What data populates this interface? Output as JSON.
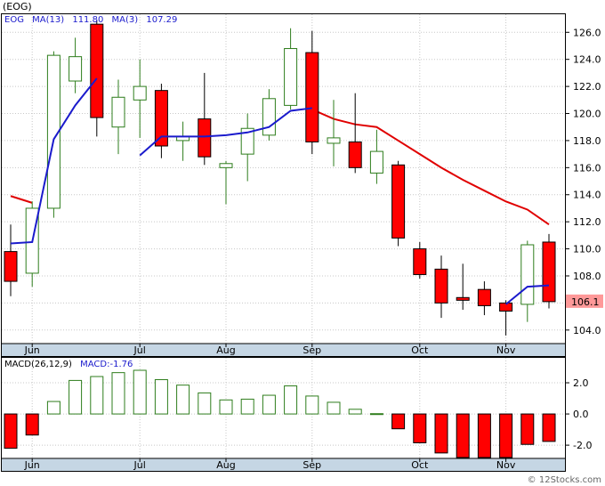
{
  "chart_data": {
    "type": "candlestick",
    "title": "(EOG)",
    "price_panel": {
      "legend": [
        {
          "text": "EOG",
          "color": "#1a1acc"
        },
        {
          "text": "MA(13)",
          "color": "#1a1acc"
        },
        {
          "text": "111.80",
          "color": "#1a1acc"
        },
        {
          "text": "MA(3)",
          "color": "#1a1acc"
        },
        {
          "text": "107.29",
          "color": "#1a1acc"
        }
      ],
      "ylim": [
        103,
        127.4
      ],
      "y_ticks": [
        104,
        106,
        108,
        110,
        112,
        114,
        116,
        118,
        120,
        122,
        124,
        126
      ],
      "y_tick_labels": [
        "104.0",
        "106.0",
        "108.0",
        "110.0",
        "112.0",
        "114.0",
        "116.0",
        "118.0",
        "120.0",
        "122.0",
        "124.0",
        "126.0"
      ],
      "last_price_label": "106.1",
      "candles": [
        {
          "open": 109.8,
          "high": 111.8,
          "low": 106.5,
          "close": 107.6
        },
        {
          "open": 108.2,
          "high": 113.5,
          "low": 107.2,
          "close": 113.0
        },
        {
          "open": 113.0,
          "high": 124.6,
          "low": 112.3,
          "close": 124.3
        },
        {
          "open": 122.4,
          "high": 125.6,
          "low": 121.5,
          "close": 124.2
        },
        {
          "open": 126.6,
          "high": 126.9,
          "low": 118.3,
          "close": 119.7
        },
        {
          "open": 119.0,
          "high": 122.5,
          "low": 117.0,
          "close": 121.2
        },
        {
          "open": 121.0,
          "high": 124.0,
          "low": 118.2,
          "close": 122.0
        },
        {
          "open": 121.7,
          "high": 122.2,
          "low": 116.7,
          "close": 117.6
        },
        {
          "open": 118.0,
          "high": 119.4,
          "low": 116.5,
          "close": 118.3
        },
        {
          "open": 119.6,
          "high": 123.0,
          "low": 116.2,
          "close": 116.8
        },
        {
          "open": 116.0,
          "high": 116.5,
          "low": 113.3,
          "close": 116.3
        },
        {
          "open": 117.0,
          "high": 120.0,
          "low": 115.0,
          "close": 118.9
        },
        {
          "open": 118.4,
          "high": 121.8,
          "low": 118.0,
          "close": 121.1
        },
        {
          "open": 120.6,
          "high": 126.3,
          "low": 120.3,
          "close": 124.8
        },
        {
          "open": 124.5,
          "high": 126.1,
          "low": 117.0,
          "close": 117.9
        },
        {
          "open": 117.8,
          "high": 121.0,
          "low": 116.1,
          "close": 118.2
        },
        {
          "open": 117.9,
          "high": 121.5,
          "low": 115.6,
          "close": 116.0
        },
        {
          "open": 115.6,
          "high": 118.8,
          "low": 114.8,
          "close": 117.2
        },
        {
          "open": 116.2,
          "high": 116.5,
          "low": 110.2,
          "close": 110.8
        },
        {
          "open": 110.0,
          "high": 110.5,
          "low": 107.8,
          "close": 108.1
        },
        {
          "open": 108.5,
          "high": 109.5,
          "low": 104.9,
          "close": 106.0
        },
        {
          "open": 106.4,
          "high": 108.9,
          "low": 105.5,
          "close": 106.2
        },
        {
          "open": 107.0,
          "high": 107.6,
          "low": 105.1,
          "close": 105.8
        },
        {
          "open": 106.0,
          "high": 106.2,
          "low": 103.6,
          "close": 105.4
        },
        {
          "open": 105.9,
          "high": 110.6,
          "low": 104.6,
          "close": 110.3
        },
        {
          "open": 110.5,
          "high": 111.1,
          "low": 105.6,
          "close": 106.1
        }
      ],
      "ma13": [
        113.9,
        113.4,
        null,
        null,
        112.8,
        null,
        null,
        null,
        null,
        null,
        null,
        null,
        null,
        null,
        120.3,
        119.6,
        119.2,
        119.0,
        118.0,
        117.0,
        116.0,
        115.1,
        114.3,
        113.5,
        112.9,
        111.8
      ],
      "ma3": [
        110.4,
        110.5,
        118.1,
        120.6,
        122.6,
        null,
        116.9,
        118.3,
        118.3,
        118.3,
        118.4,
        118.6,
        119.0,
        120.2,
        120.4,
        null,
        null,
        null,
        null,
        null,
        null,
        null,
        null,
        105.9,
        107.2,
        107.3
      ]
    },
    "macd_panel": {
      "legend": [
        {
          "text": "MACD(26,12,9)",
          "color": "#000000"
        },
        {
          "text": "MACD:-1.76",
          "color": "#1a1acc"
        }
      ],
      "ylim": [
        -2.85,
        3.6
      ],
      "y_ticks": [
        2.0,
        0.0,
        -2.0
      ],
      "y_tick_labels": [
        "2.0",
        "0.0",
        "-2.0"
      ],
      "values": [
        -2.2,
        -1.35,
        0.8,
        2.15,
        2.4,
        2.65,
        2.8,
        2.2,
        1.85,
        1.35,
        0.9,
        0.95,
        1.2,
        1.8,
        1.15,
        0.75,
        0.3,
        0.02,
        -0.95,
        -1.85,
        -2.5,
        -2.95,
        -2.95,
        -2.85,
        -1.95,
        -1.76
      ]
    },
    "x_axis": {
      "labels": [
        {
          "text": "Jun",
          "index": 1
        },
        {
          "text": "Jul",
          "index": 6
        },
        {
          "text": "Aug",
          "index": 10
        },
        {
          "text": "Sep",
          "index": 14
        },
        {
          "text": "Oct",
          "index": 19
        },
        {
          "text": "Nov",
          "index": 23
        }
      ]
    },
    "watermark": "© 12Stocks.com",
    "colors": {
      "up_fill": "#ffffff",
      "up_stroke": "#2e7d1c",
      "down_fill": "#ff0000",
      "down_stroke": "#000000",
      "ma13": "#e00000",
      "ma3": "#1a1acc",
      "macd_up_stroke": "#2e7d1c",
      "macd_down_fill": "#ff0000",
      "axis_bar": "#c5d6e4",
      "grid": "#c8c8c8",
      "last_price_bg": "#ff9999"
    }
  }
}
